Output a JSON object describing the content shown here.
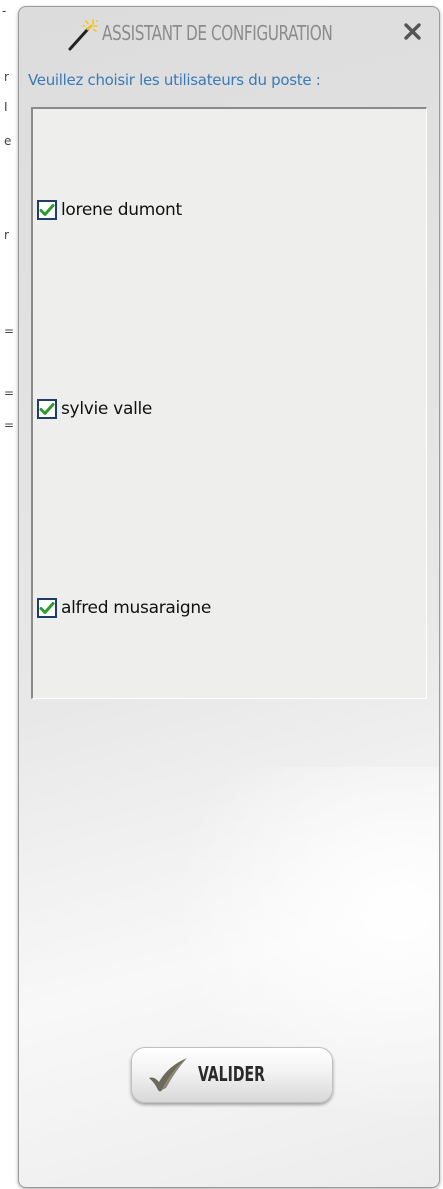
{
  "window": {
    "title": "ASSISTANT DE CONFIGURATION",
    "close_symbol": "✕",
    "icons": {
      "title": "magic-wand-icon",
      "close": "close-icon",
      "validate": "check-mark-icon"
    }
  },
  "prompt": "Veuillez choisir les utilisateurs du poste :",
  "users": [
    {
      "name": "lorene dumont",
      "checked": true
    },
    {
      "name": "sylvie valle",
      "checked": true
    },
    {
      "name": "alfred musaraigne",
      "checked": true
    }
  ],
  "actions": {
    "validate_label": "VALIDER"
  },
  "colors": {
    "title_text": "#8c8c8c",
    "prompt_text": "#3a7ab8",
    "checkbox_border": "#1e3d6a",
    "checkmark": "#2e9a2e"
  }
}
